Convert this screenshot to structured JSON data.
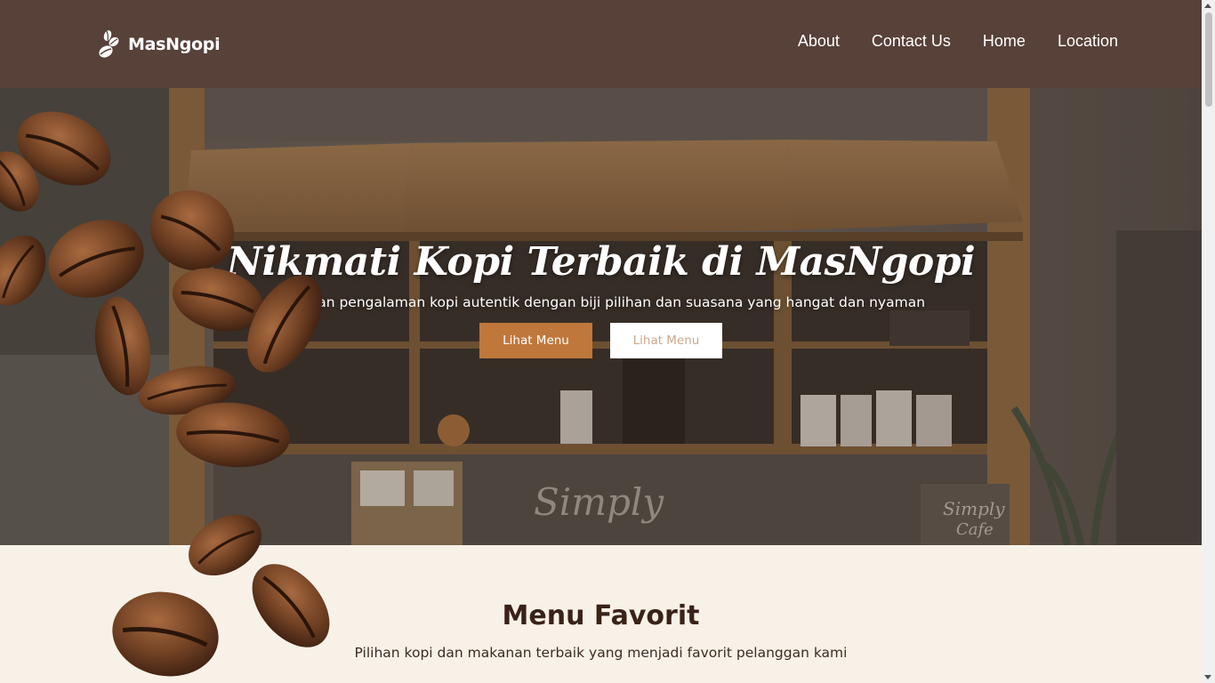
{
  "brand": {
    "name": "MasNgopi",
    "logo_icon": "coffee-beans-icon"
  },
  "nav": {
    "items": [
      {
        "label": "About"
      },
      {
        "label": "Contact Us"
      },
      {
        "label": "Home"
      },
      {
        "label": "Location"
      }
    ]
  },
  "hero": {
    "title": "Nikmati Kopi Terbaik di MasNgopi",
    "subtitle": "Rasakan pengalaman kopi autentik dengan biji pilihan dan suasana yang hangat dan nyaman",
    "primary_button": "Lihat Menu",
    "secondary_button": "Lihat Menu"
  },
  "menu_section": {
    "title": "Menu Favorit",
    "subtitle": "Pilihan kopi dan makanan terbaik yang menjadi favorit pelanggan kami"
  },
  "colors": {
    "navbar": "#574139",
    "accent": "#c0773c",
    "section_bg": "#f8f1e8",
    "title_text": "#3a2218"
  }
}
